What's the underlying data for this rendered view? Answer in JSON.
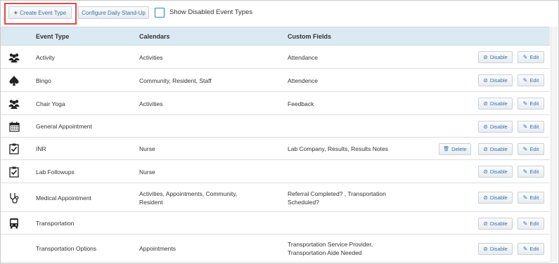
{
  "toolbar": {
    "create_label": "Create Event Type",
    "standup_label": "Configure Daily Stand-Up",
    "show_disabled_label": "Show Disabled Event Types",
    "show_disabled_checked": false,
    "highlight_color": "#e04a4a"
  },
  "table": {
    "headers": {
      "event_type": "Event Type",
      "calendars": "Calendars",
      "custom_fields": "Custom Fields"
    },
    "disable_label": "Disable",
    "edit_label": "Edit",
    "delete_label": "Delete",
    "rows": [
      {
        "icon": "group-icon",
        "event_type": "Activity",
        "calendars": "Activities",
        "custom_fields": "Attendance",
        "deletable": false
      },
      {
        "icon": "spade-icon",
        "event_type": "Bingo",
        "calendars": "Community, Resident, Staff",
        "custom_fields": "Attendence",
        "deletable": false
      },
      {
        "icon": "group-icon",
        "event_type": "Chair Yoga",
        "calendars": "Activities",
        "custom_fields": "Feedback",
        "deletable": false
      },
      {
        "icon": "calendar-icon",
        "event_type": "General Appointment",
        "calendars": "",
        "custom_fields": "",
        "deletable": false
      },
      {
        "icon": "clipboard-check-icon",
        "event_type": "INR",
        "calendars": "Nurse",
        "custom_fields": "Lab Company, Results, Results Notes",
        "deletable": true
      },
      {
        "icon": "clipboard-check-icon",
        "event_type": "Lab Followups",
        "calendars": "Nurse",
        "custom_fields": "",
        "deletable": false
      },
      {
        "icon": "stethoscope-icon",
        "event_type": "Medical Appointment",
        "calendars": [
          "Activities, Appointments, Community,",
          "Resident"
        ],
        "custom_fields": [
          "Referral Completed? , Transportation",
          "Scheduled?"
        ],
        "deletable": false
      },
      {
        "icon": "bus-icon",
        "event_type": "Transportation",
        "calendars": "",
        "custom_fields": "",
        "deletable": false
      },
      {
        "icon": "none",
        "event_type": "Transportation Options",
        "calendars": "Appointments",
        "custom_fields": [
          "Transportation Service Provider,",
          "Transportation Aide Needed"
        ],
        "deletable": false
      }
    ]
  }
}
